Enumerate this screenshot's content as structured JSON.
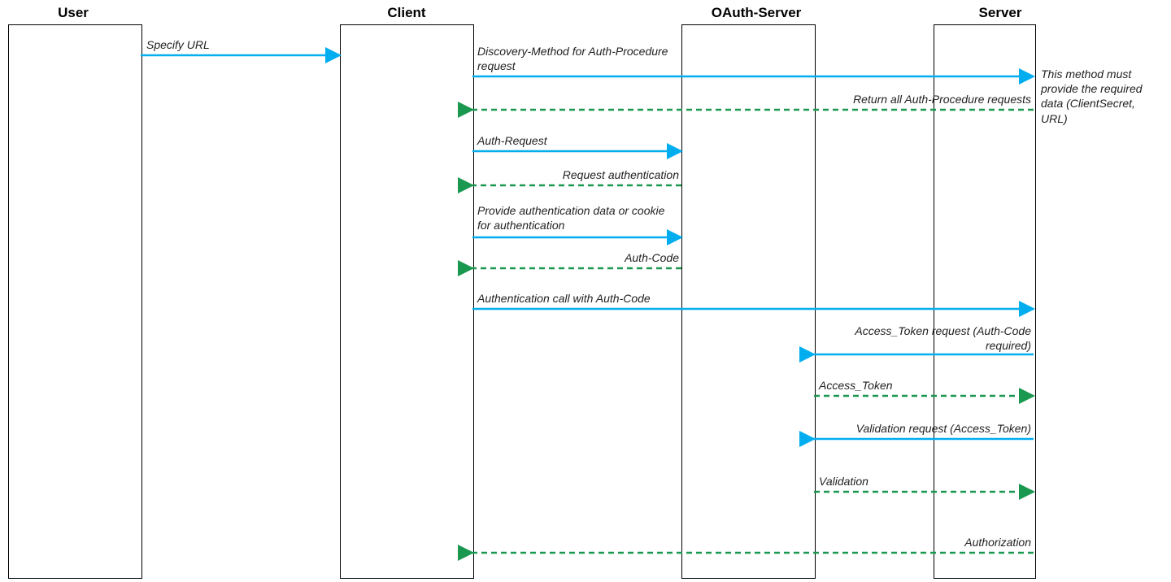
{
  "chart_data": {
    "type": "sequence-diagram",
    "participants": [
      "User",
      "Client",
      "OAuth-Server",
      "Server"
    ],
    "messages": [
      {
        "from": "User",
        "to": "Client",
        "label": "Specify URL",
        "style": "sync"
      },
      {
        "from": "Client",
        "to": "Server",
        "label": "Discovery-Method for Auth-Procedure request",
        "style": "sync"
      },
      {
        "from": "Server",
        "to": "Client",
        "label": "Return all Auth-Procedure requests",
        "style": "return"
      },
      {
        "from": "Client",
        "to": "OAuth-Server",
        "label": "Auth-Request",
        "style": "sync"
      },
      {
        "from": "OAuth-Server",
        "to": "Client",
        "label": "Request authentication",
        "style": "return"
      },
      {
        "from": "Client",
        "to": "OAuth-Server",
        "label": "Provide authentication data or cookie for authentication",
        "style": "sync"
      },
      {
        "from": "OAuth-Server",
        "to": "Client",
        "label": "Auth-Code",
        "style": "return"
      },
      {
        "from": "Client",
        "to": "Server",
        "label": "Authentication call with Auth-Code",
        "style": "sync"
      },
      {
        "from": "Server",
        "to": "OAuth-Server",
        "label": "Access_Token request (Auth-Code required)",
        "style": "sync"
      },
      {
        "from": "OAuth-Server",
        "to": "Server",
        "label": "Access_Token",
        "style": "return"
      },
      {
        "from": "Server",
        "to": "OAuth-Server",
        "label": "Validation request (Access_Token)",
        "style": "sync"
      },
      {
        "from": "OAuth-Server",
        "to": "Server",
        "label": "Validation",
        "style": "return"
      },
      {
        "from": "Server",
        "to": "Client",
        "label": "Authorization",
        "style": "return"
      }
    ],
    "notes": [
      {
        "attached_to": "Server",
        "text": "This method must provide the required data (ClientSecret, URL)"
      }
    ]
  },
  "labels": {
    "user": "User",
    "client": "Client",
    "oauth": "OAuth-Server",
    "server": "Server",
    "specify_url": "Specify URL",
    "discovery": "Discovery-Method for Auth-Procedure request",
    "return_auth_proc": "Return all Auth-Procedure requests",
    "auth_request": "Auth-Request",
    "request_auth": "Request authentication",
    "provide_auth": "Provide authentication data or cookie for authentication",
    "auth_code": "Auth-Code",
    "auth_call": "Authentication call with Auth-Code",
    "access_token_req": "Access_Token request (Auth-Code required)",
    "access_token": "Access_Token",
    "validation_req": "Validation request (Access_Token)",
    "validation": "Validation",
    "authorization": "Authorization",
    "note1": "This method must provide the required data (ClientSecret, URL)"
  },
  "colors": {
    "sync": "#00aeef",
    "return": "#1a9850",
    "text": "#222222"
  }
}
